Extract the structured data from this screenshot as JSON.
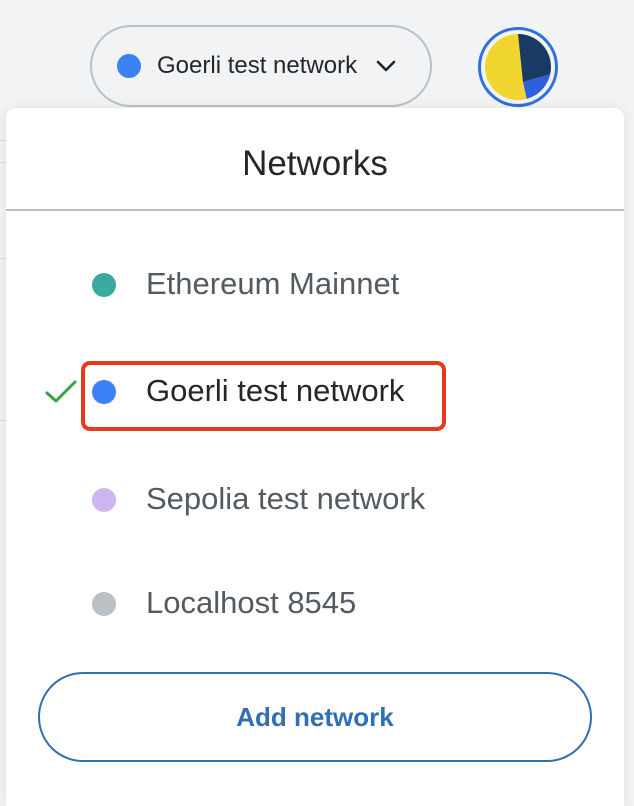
{
  "header": {
    "selected_network": {
      "label": "Goerli test network",
      "dot_color": "#3b82f6",
      "chevron_icon": "chevron-down-icon"
    },
    "account_avatar": {
      "icon": "jazzicon-avatar",
      "colors": [
        "#f1d631",
        "#1a3a66",
        "#2f5fe0"
      ]
    }
  },
  "networks_menu": {
    "title": "Networks",
    "items": [
      {
        "label": "Ethereum Mainnet",
        "dot_color": "#3aaa9e",
        "selected": false
      },
      {
        "label": "Goerli test network",
        "dot_color": "#3b82f6",
        "selected": true,
        "check_icon": "check-icon",
        "check_color": "#3ea146",
        "highlight_color": "#e8391d"
      },
      {
        "label": "Sepolia test network",
        "dot_color": "#cfb5f0",
        "selected": false
      },
      {
        "label": "Localhost 8545",
        "dot_color": "#bbc0c5",
        "selected": false
      }
    ],
    "add_network_label": "Add network",
    "accent_color": "#2f6fb4"
  }
}
